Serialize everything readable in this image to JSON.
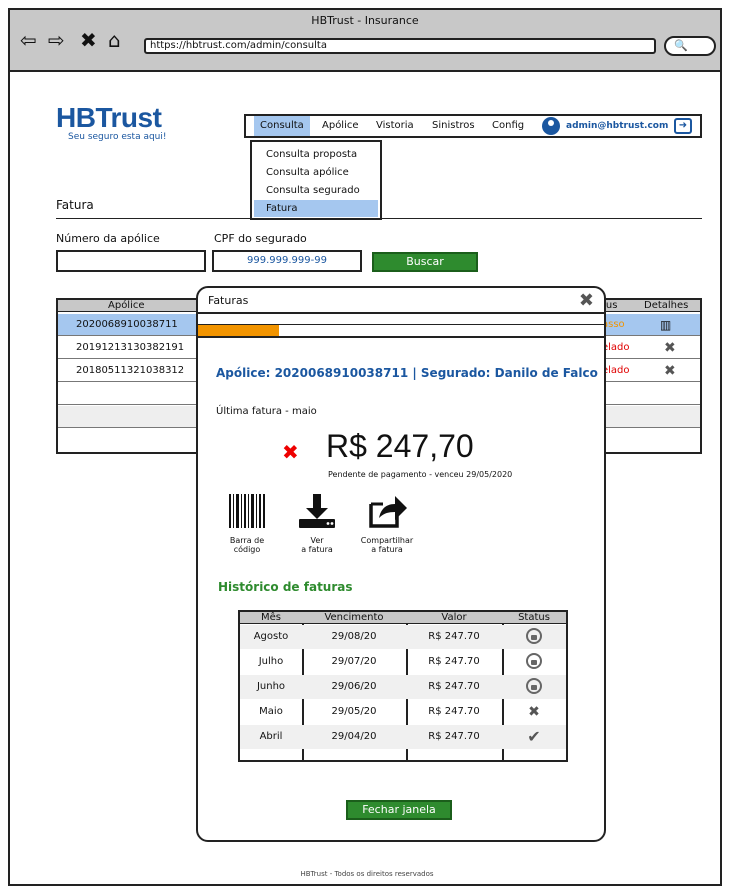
{
  "browser": {
    "window_title": "HBTrust - Insurance",
    "url": "https://hbtrust.com/admin/consulta"
  },
  "brand": {
    "logo": "HBTrust",
    "tagline": "Seu seguro esta aqui!"
  },
  "navbar": {
    "items": [
      "Consulta",
      "Apólice",
      "Vistoria",
      "Sinistros",
      "Config"
    ],
    "active": "Consulta",
    "user_email": "admin@hbtrust.com"
  },
  "dropdown": {
    "items": [
      "Consulta proposta",
      "Consulta apólice",
      "Consulta segurado",
      "Fatura"
    ],
    "active": "Fatura"
  },
  "page": {
    "section_title": "Fatura",
    "policy_label": "Número da apólice",
    "policy_value": "",
    "cpf_label": "CPF do segurado",
    "cpf_value": "999.999.999-99",
    "search_button": "Buscar"
  },
  "results_table": {
    "headers": {
      "policy": "Apólice",
      "status": "tus",
      "details": "Detalhes"
    },
    "rows": [
      {
        "policy": "2020068910038711",
        "status": "asso",
        "status_color": "#f29400",
        "details_icon": "barcode"
      },
      {
        "policy": "20191213130382191",
        "status": "elado",
        "status_color": "#e00000",
        "details_icon": "close"
      },
      {
        "policy": "20180511321038312",
        "status": "elado",
        "status_color": "#e00000",
        "details_icon": "close"
      }
    ]
  },
  "modal": {
    "title": "Faturas",
    "progress": 0.2,
    "policy_line": "Apólice: 2020068910038711 | Segurado: Danilo de Falco",
    "last_invoice_label": "Última fatura - maio",
    "amount": "R$ 247,70",
    "due_text": "Pendente de pagamento - venceu 29/05/2020",
    "actions": [
      {
        "label1": "Barra de",
        "label2": "código",
        "icon": "barcode"
      },
      {
        "label1": "Ver",
        "label2": "a fatura",
        "icon": "download"
      },
      {
        "label1": "Compartilhar",
        "label2": "a fatura",
        "icon": "share"
      }
    ],
    "history_title": "Histórico de faturas",
    "history": {
      "headers": [
        "Mês",
        "Vencimento",
        "Valor",
        "Status"
      ],
      "rows": [
        {
          "month": "Agosto",
          "due": "29/08/20",
          "value": "R$ 247.70",
          "status": "lock"
        },
        {
          "month": "Julho",
          "due": "29/07/20",
          "value": "R$ 247.70",
          "status": "lock"
        },
        {
          "month": "Junho",
          "due": "29/06/20",
          "value": "R$ 247.70",
          "status": "lock"
        },
        {
          "month": "Maio",
          "due": "29/05/20",
          "value": "R$ 247.70",
          "status": "x"
        },
        {
          "month": "Abril",
          "due": "29/04/20",
          "value": "R$ 247.70",
          "status": "check"
        }
      ]
    },
    "close_button": "Fechar janela"
  },
  "footer": "HBTrust - Todos os direitos reservados",
  "colors": {
    "brand_blue": "#1b57a0",
    "accent_green": "#2e8b2e",
    "selection": "#a5c7ef",
    "warning_orange": "#f29400",
    "error_red": "#e00000"
  }
}
